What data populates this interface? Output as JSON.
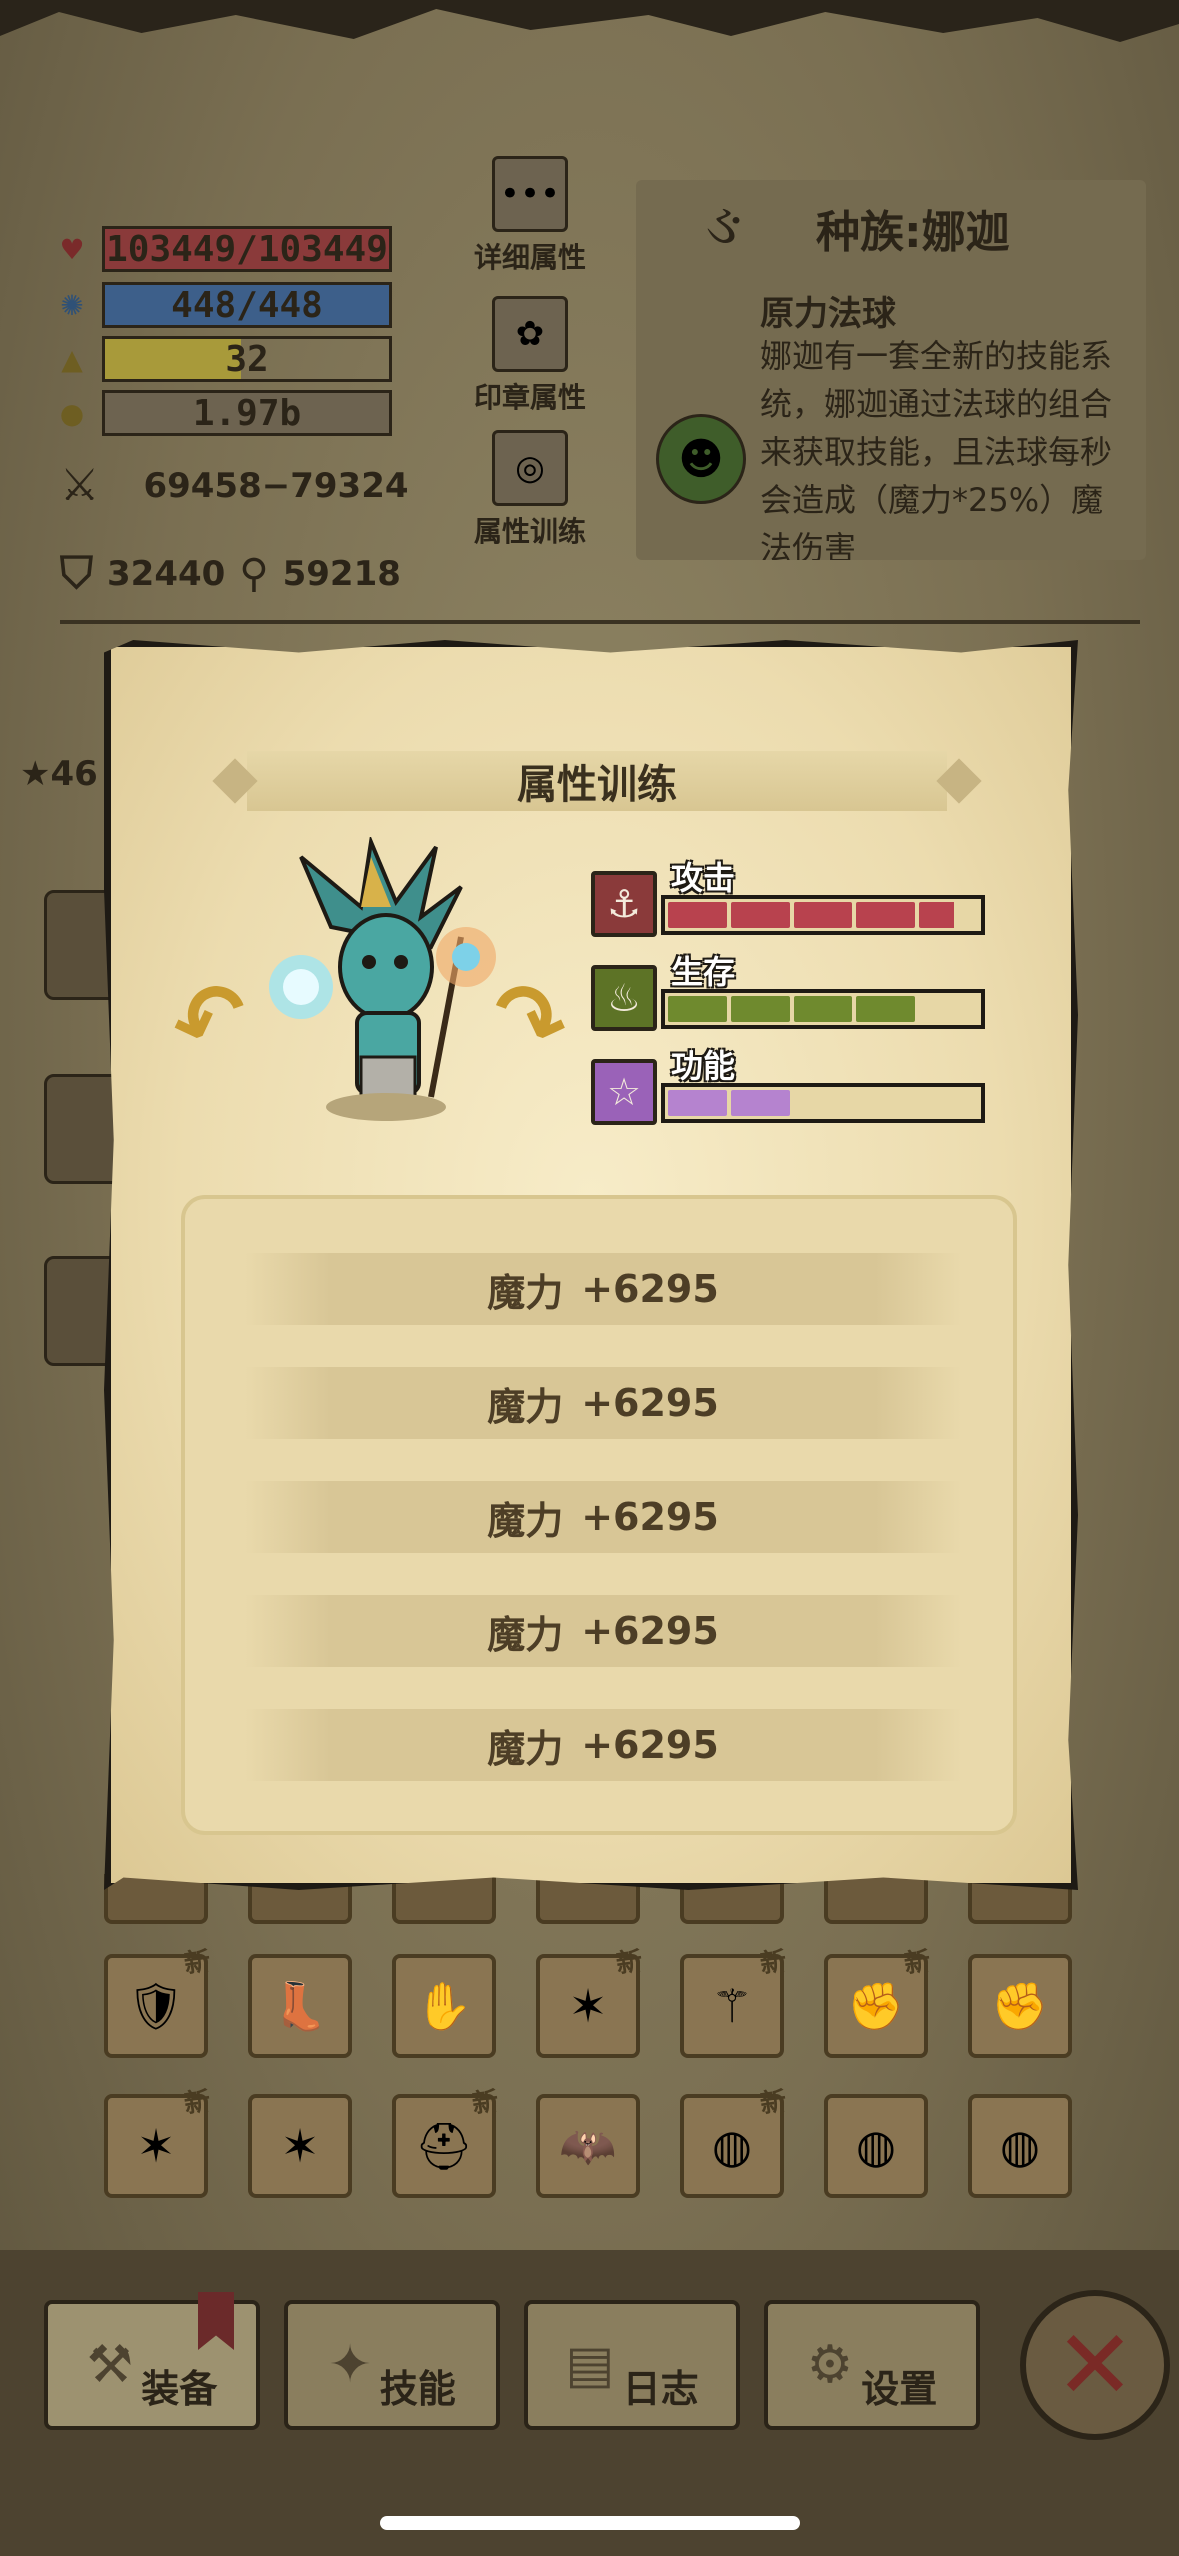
{
  "stats": {
    "hp": "103449/103449",
    "mp": "448/448",
    "level": "32",
    "gold": "1.97b",
    "attack": "69458−79324",
    "defense": "32440",
    "magic_power": "59218"
  },
  "side_buttons": [
    {
      "label": "详细属性",
      "icon": "dots-icon"
    },
    {
      "label": "印章属性",
      "icon": "flower-seal-icon"
    },
    {
      "label": "属性训练",
      "icon": "target-icon"
    }
  ],
  "race": {
    "title": "种族:娜迦",
    "skill_name": "原力法球",
    "skill_desc": "娜迦有一套全新的技能系统，娜迦通过法球的组合来获取技能，且法球每秒会造成（魔力*25%）魔法伤害"
  },
  "background": {
    "star_count": "46"
  },
  "modal": {
    "title": "属性训练",
    "training": [
      {
        "label": "攻击",
        "icon": "anchor-icon",
        "color": "#b8424e",
        "bg": "#8a3a3a",
        "progress": 4.6
      },
      {
        "label": "生存",
        "icon": "flame-leaf-icon",
        "color": "#6f8a2e",
        "bg": "#5d7326",
        "progress": 4.0
      },
      {
        "label": "功能",
        "icon": "star-icon",
        "color": "#b583cf",
        "bg": "#9a62b8",
        "progress": 2.0
      }
    ],
    "attributes": [
      {
        "name": "魔力",
        "value": "+6295"
      },
      {
        "name": "魔力",
        "value": "+6295"
      },
      {
        "name": "魔力",
        "value": "+6295"
      },
      {
        "name": "魔力",
        "value": "+6295"
      },
      {
        "name": "魔力",
        "value": "+6295"
      }
    ]
  },
  "equipment": {
    "new_label": "新",
    "rows": [
      [
        {
          "icon": "armor-icon",
          "new": true
        },
        {
          "icon": "boots-icon",
          "new": false
        },
        {
          "icon": "bracer-icon",
          "new": false
        },
        {
          "icon": "claw-icon",
          "new": true
        },
        {
          "icon": "staff-icon",
          "new": true
        },
        {
          "icon": "glove-icon",
          "new": true
        },
        {
          "icon": "glove-icon",
          "new": false
        }
      ],
      [
        {
          "icon": "claw-icon",
          "new": true
        },
        {
          "icon": "claw-icon",
          "new": false
        },
        {
          "icon": "helmet-icon",
          "new": true
        },
        {
          "icon": "bat-icon",
          "new": false
        },
        {
          "icon": "ring-icon",
          "new": true
        },
        {
          "icon": "ring-icon",
          "new": false
        },
        {
          "icon": "ring-icon",
          "new": false
        }
      ]
    ]
  },
  "nav": [
    {
      "label": "装备",
      "icon": "axe-icon"
    },
    {
      "label": "技能",
      "icon": "skill-icon"
    },
    {
      "label": "日志",
      "icon": "journal-icon"
    },
    {
      "label": "设置",
      "icon": "gear-icon"
    }
  ],
  "colors": {
    "hp_bar": "#8a3a3a",
    "mp_bar": "#3d5f8a",
    "level_bar": "#a89a3a"
  }
}
